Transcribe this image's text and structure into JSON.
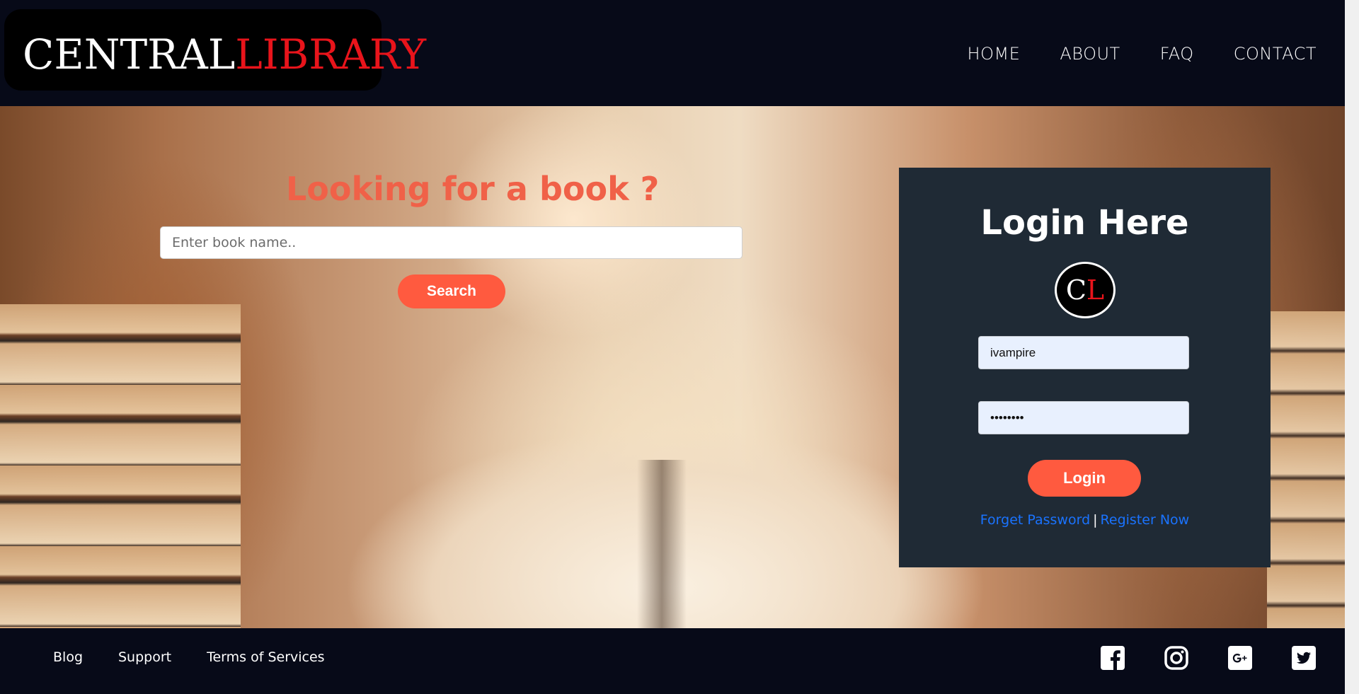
{
  "header": {
    "logo_central": "CENTRAL",
    "logo_library": "LIBRARY",
    "nav": [
      {
        "label": "HOME"
      },
      {
        "label": "ABOUT"
      },
      {
        "label": "FAQ"
      },
      {
        "label": "CONTACT"
      }
    ]
  },
  "search": {
    "title": "Looking for a book ?",
    "placeholder": "Enter book name..",
    "button_label": "Search"
  },
  "login": {
    "title": "Login Here",
    "avatar_c": "C",
    "avatar_l": "L",
    "username_value": "ivampire",
    "password_value": "••••••••",
    "button_label": "Login",
    "forget_label": "Forget Password",
    "separator": "|",
    "register_label": "Register Now"
  },
  "footer": {
    "links": [
      {
        "label": "Blog"
      },
      {
        "label": "Support"
      },
      {
        "label": "Terms of Services"
      }
    ],
    "social": [
      "facebook-icon",
      "instagram-icon",
      "google-plus-icon",
      "twitter-icon"
    ]
  },
  "colors": {
    "accent": "#ff5a3f",
    "title_accent": "#f06148",
    "logo_red": "#e8141b",
    "header_bg": "#070a18",
    "login_panel_bg": "#1f2a35",
    "link_blue": "#1a73ff"
  }
}
